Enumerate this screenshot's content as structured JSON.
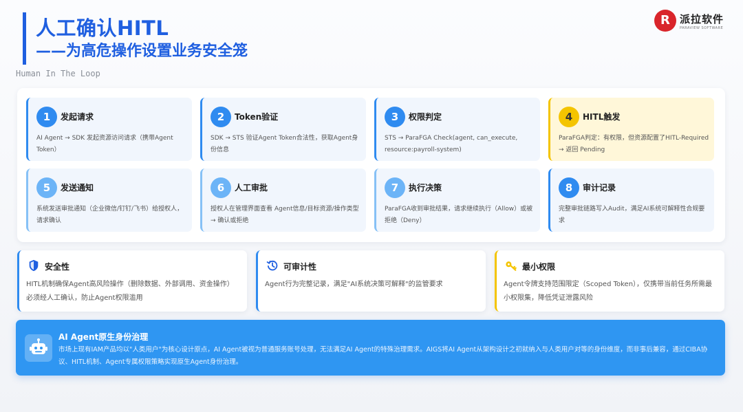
{
  "header": {
    "title": "人工确认HITL",
    "subtitle": "——为高危操作设置业务安全笼",
    "caption": "Human In The Loop"
  },
  "logo": {
    "name": "派拉软件",
    "tagline": "PARAVIEW SOFTWARE",
    "brand_color": "#d9252b"
  },
  "accent_color": "#1f5fe0",
  "steps": [
    {
      "number": "1",
      "title": "发起请求",
      "desc": "AI Agent → SDK 发起资源访问请求（携带Agent Token）"
    },
    {
      "number": "2",
      "title": "Token验证",
      "desc": "SDK → STS 验证Agent Token合法性，获取Agent身份信息"
    },
    {
      "number": "3",
      "title": "权限判定",
      "desc": "STS → ParaFGA Check(agent, can_execute, resource:payroll-system)"
    },
    {
      "number": "4",
      "title": "HITL触发",
      "desc": "ParaFGA判定：有权限，但资源配置了HITL-Required → 返回 Pending"
    },
    {
      "number": "5",
      "title": "发送通知",
      "desc": "系统发送审批通知（企业微信/钉钉/飞书）给授权人，请求确认"
    },
    {
      "number": "6",
      "title": "人工审批",
      "desc": "授权人在管理界面查看 Agent信息/目标资源/操作类型 → 确认或拒绝"
    },
    {
      "number": "7",
      "title": "执行决策",
      "desc": "ParaFGA收到审批结果，请求继续执行（Allow）或被拒绝（Deny）"
    },
    {
      "number": "8",
      "title": "审计记录",
      "desc": "完整审批链路写入Audit，满足AI系统可解释性合规要求"
    }
  ],
  "features": [
    {
      "icon": "shield-icon",
      "title": "安全性",
      "desc": "HITL机制确保Agent高风险操作（删除数据、外部调用、资金操作）必须经人工确认，防止Agent权限滥用"
    },
    {
      "icon": "history-icon",
      "title": "可审计性",
      "desc": "Agent行为完整记录，满足\"AI系统决策可解释\"的监管要求"
    },
    {
      "icon": "key-icon",
      "title": "最小权限",
      "desc": "Agent令牌支持范围限定（Scoped Token），仅携带当前任务所需最小权限集，降低凭证泄露风险"
    }
  ],
  "banner": {
    "icon": "robot-icon",
    "title": "AI Agent原生身份治理",
    "desc": "市场上现有IAM产品均以\"人类用户\"为核心设计原点，AI Agent被视为普通服务账号处理，无法满足AI Agent的特殊治理需求。AIGS将AI Agent从架构设计之初就纳入与人类用户对等的身份维度，而非事后兼容，通过CIBA协议、HITL机制、Agent专属权限策略实现原生Agent身份治理。"
  }
}
